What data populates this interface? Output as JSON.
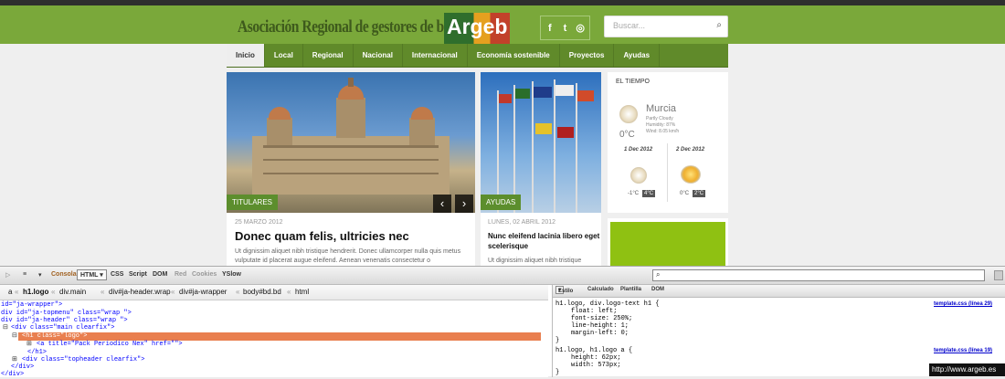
{
  "site": {
    "logo_text": "Asociación Regional de gestores de biomasa",
    "brand": "Argeb",
    "social": [
      "f",
      "t",
      "rss"
    ],
    "search_placeholder": "Buscar...",
    "nav": [
      "Inicio",
      "Local",
      "Regional",
      "Nacional",
      "Internacional",
      "Economía sostenible",
      "Proyectos",
      "Ayudas"
    ],
    "nav_active": "Inicio",
    "hero": {
      "category": "TITULARES",
      "date": "25 MARZO 2012",
      "title": "Donec quam felis, ultricies nec",
      "body": "Ut dignissim aliquet nibh tristique hendrerit. Donec ullamcorper nulla quis metus vulputate id placerat augue eleifend. Aenean venenatis consectetur o"
    },
    "second": {
      "category": "AYUDAS",
      "date": "LUNES, 02 ABRIL 2012",
      "title_line1": "Nunc eleifend lacinia libero eget",
      "title_line2": "scelerisque",
      "body": "Ut dignissim aliquet nibh tristique"
    },
    "weather": {
      "heading": "EL TIEMPO",
      "city": "Murcia",
      "condition": "Partly Cloudy",
      "humidity": "Humidity: 87%",
      "wind": "Wind: 8.05 km/h",
      "temp": "0°C",
      "days": [
        {
          "date": "1 Dec 2012",
          "low": "-1°C",
          "high": "4°C"
        },
        {
          "date": "2 Dec 2012",
          "low": "0°C",
          "high": "2°C"
        }
      ]
    }
  },
  "devtools": {
    "toolbar": [
      "Consola",
      "HTML",
      "CSS",
      "Script",
      "DOM",
      "Red",
      "Cookies",
      "YSlow"
    ],
    "breadcrumb": [
      "a",
      "h1.logo",
      "div.main",
      "div#ja-header.wrap",
      "div#ja-wrapper",
      "body#bd.bd",
      "html"
    ],
    "html_lines": [
      "id=\"ja-wrapper\">",
      "div id=\"ja-topmenu\" class=\"wrap \">",
      "div id=\"ja-header\" class=\"wrap \">",
      "<div class=\"main clearfix\">",
      "<h1 class=\"logo\">",
      "<a title=\"Pack Periodico Nex\" href=\"\">",
      "</h1>",
      "<div class=\"topheader clearfix\">",
      "</div>",
      "</div>"
    ],
    "side_tabs": [
      "Estilo",
      "Calculado",
      "Plantilla",
      "DOM"
    ],
    "css_rules": [
      {
        "selector": "h1.logo, div.logo-text h1 {",
        "file": "template.css (línea 29)",
        "props": [
          "float: left;",
          "font-size: 250%;",
          "line-height: 1;",
          "margin-left: 0;"
        ]
      },
      {
        "selector": "h1.logo, h1.logo a {",
        "file": "template.css (línea 19)",
        "props": [
          "height: 62px;",
          "width: 573px;"
        ]
      }
    ],
    "tooltip": "http://www.argeb.es"
  }
}
